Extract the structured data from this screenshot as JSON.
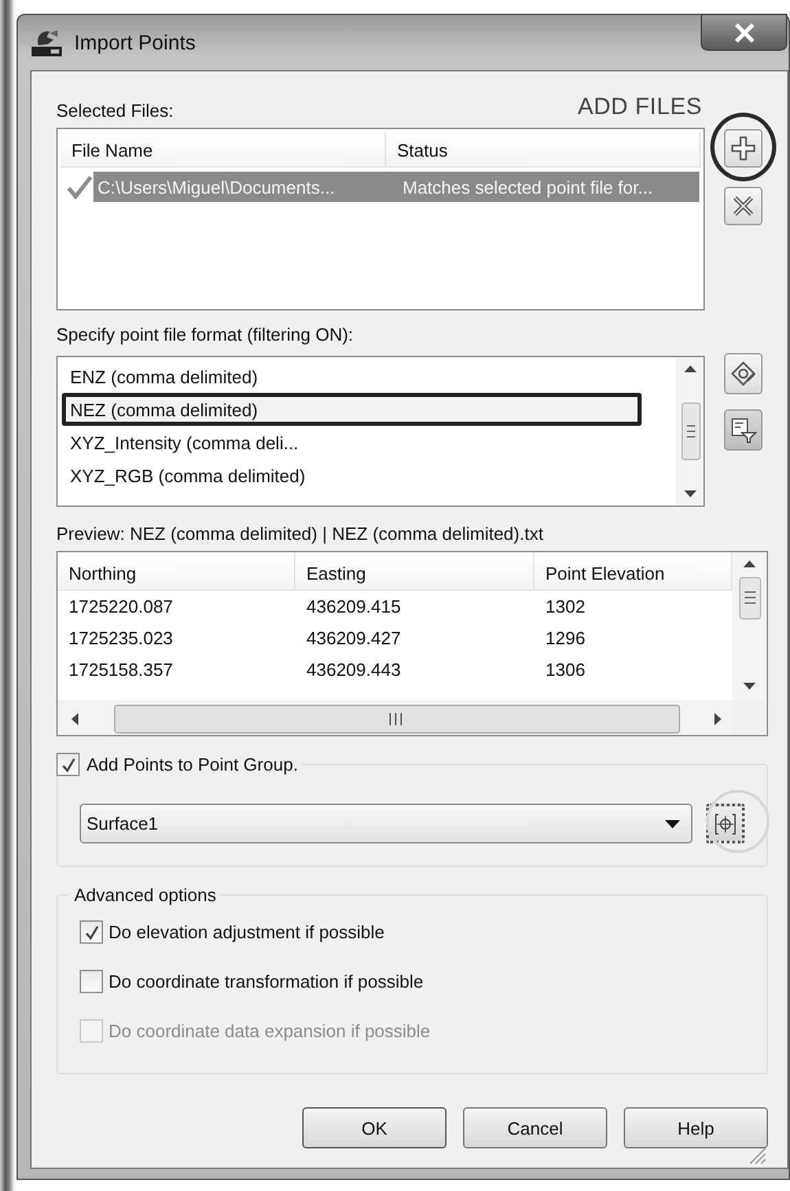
{
  "window": {
    "title": "Import Points"
  },
  "annotation": {
    "text": "ADD FILES"
  },
  "selected_files": {
    "label": "Selected Files:",
    "columns": [
      "File Name",
      "Status"
    ],
    "rows": [
      {
        "checked": true,
        "selected": true,
        "file_name": "C:\\Users\\Miguel\\Documents...",
        "status": "Matches selected point file for..."
      }
    ]
  },
  "format": {
    "label": "Specify point file format (filtering ON):",
    "items": [
      {
        "label": "ENZ (comma delimited)",
        "selected": false
      },
      {
        "label": "NEZ (comma delimited)",
        "selected": true
      },
      {
        "label": "XYZ_Intensity (comma deli...",
        "selected": false
      },
      {
        "label": "XYZ_RGB (comma delimited)",
        "selected": false
      }
    ]
  },
  "preview": {
    "label": "Preview: NEZ (comma delimited) | NEZ (comma delimited).txt",
    "columns": [
      "Northing",
      "Easting",
      "Point Elevation"
    ],
    "rows": [
      [
        "1725220.087",
        "436209.415",
        "1302"
      ],
      [
        "1725235.023",
        "436209.427",
        "1296"
      ],
      [
        "1725158.357",
        "436209.443",
        "1306"
      ]
    ]
  },
  "point_group": {
    "label": "Add Points to Point Group.",
    "checked": true,
    "value": "Surface1"
  },
  "advanced": {
    "title": "Advanced options",
    "options": [
      {
        "label": "Do elevation adjustment if possible",
        "checked": true,
        "disabled": false
      },
      {
        "label": "Do coordinate transformation if possible",
        "checked": false,
        "disabled": false
      },
      {
        "label": "Do coordinate data expansion if possible",
        "checked": false,
        "disabled": true
      }
    ]
  },
  "buttons": [
    "OK",
    "Cancel",
    "Help"
  ]
}
